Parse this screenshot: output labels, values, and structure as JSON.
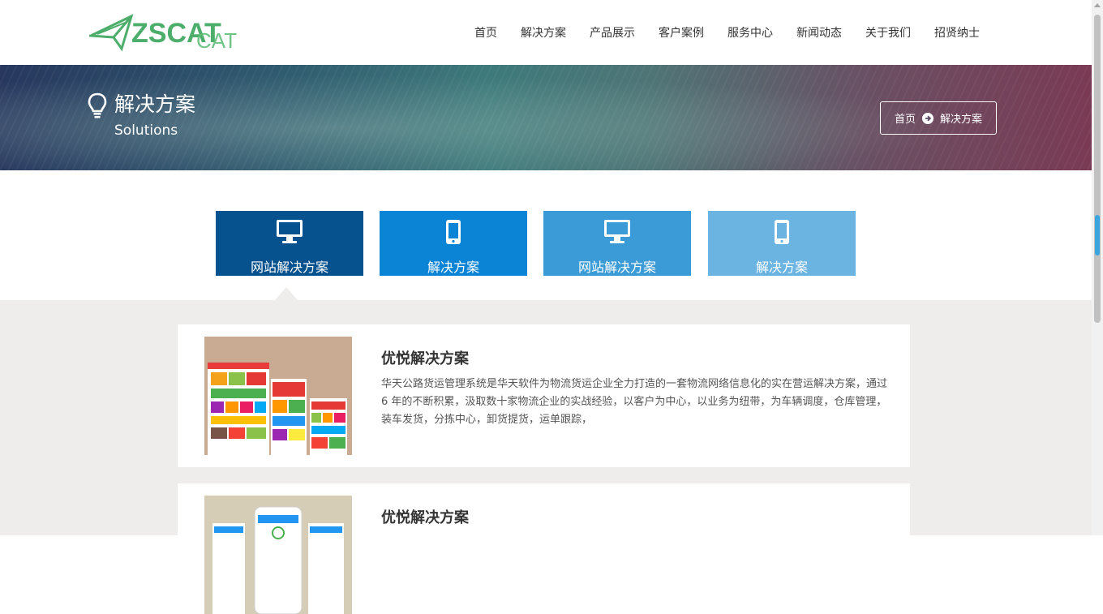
{
  "logo": {
    "text": "ZSCAT"
  },
  "nav": [
    "首页",
    "解决方案",
    "产品展示",
    "客户案例",
    "服务中心",
    "新闻动态",
    "关于我们",
    "招贤纳士"
  ],
  "banner": {
    "title": "解决方案",
    "subtitle": "Solutions",
    "icon": "lightbulb-icon",
    "breadcrumb": {
      "home": "首页",
      "current": "解决方案",
      "separator_icon": "arrow-circle-right-icon"
    }
  },
  "tabs": [
    {
      "label": "网站解决方案",
      "icon": "desktop-icon",
      "color": "#05528f"
    },
    {
      "label": "解决方案",
      "icon": "mobile-icon",
      "color": "#0b84d6"
    },
    {
      "label": "网站解决方案",
      "icon": "desktop-icon",
      "color": "#3b9bd6"
    },
    {
      "label": "解决方案",
      "icon": "mobile-icon",
      "color": "#6bb4e2"
    }
  ],
  "solutions": [
    {
      "title": "优悦解决方案",
      "desc": "华天公路货运管理系统是华天软件为物流货运企业全力打造的一套物流网络信息化的实在营运解决方案，通过 6 年的不断积累，汲取数十家物流企业的实战经验，以客户为中心，以业务为纽带，为车辆调度，仓库管理，装车发货，分拣中心，卸货提货，运单跟踪，"
    },
    {
      "title": "优悦解决方案",
      "desc": ""
    }
  ],
  "colors": {
    "logo_green": "#4cae6a",
    "content_bg": "#eeedeb"
  }
}
